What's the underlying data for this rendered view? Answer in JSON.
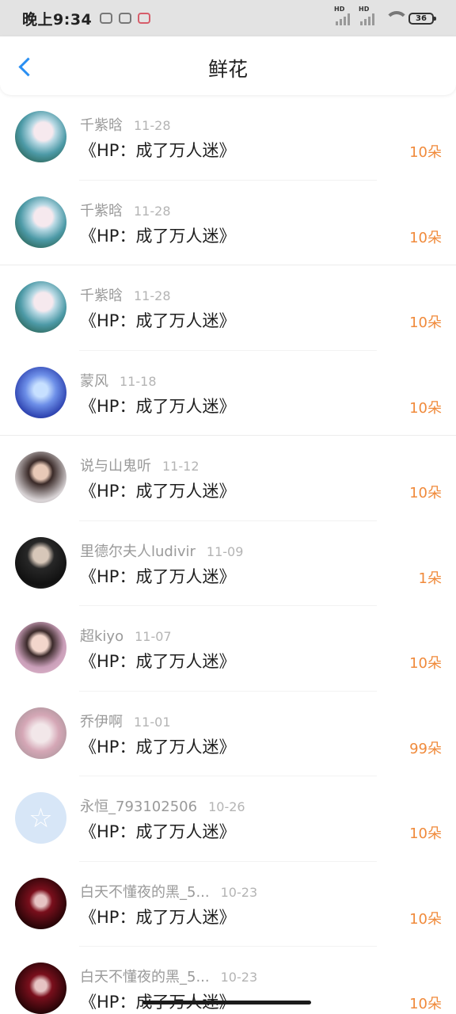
{
  "status_bar": {
    "time": "晚上9:34",
    "hd1": "HD",
    "hd2": "HD",
    "wifi_badge": "6",
    "battery": "36"
  },
  "header": {
    "title": "鲜花"
  },
  "items": [
    {
      "user": "千紫晗",
      "date": "11-28",
      "book": "《HP：成了万人迷》",
      "amount": "10朵"
    },
    {
      "user": "千紫晗",
      "date": "11-28",
      "book": "《HP：成了万人迷》",
      "amount": "10朵"
    },
    {
      "user": "千紫晗",
      "date": "11-28",
      "book": "《HP：成了万人迷》",
      "amount": "10朵"
    },
    {
      "user": "蒙风",
      "date": "11-18",
      "book": "《HP：成了万人迷》",
      "amount": "10朵"
    },
    {
      "user": "说与山鬼听",
      "date": "11-12",
      "book": "《HP：成了万人迷》",
      "amount": "10朵"
    },
    {
      "user": "里德尔夫人ludivir",
      "date": "11-09",
      "book": "《HP：成了万人迷》",
      "amount": "1朵"
    },
    {
      "user": "超kiyo",
      "date": "11-07",
      "book": "《HP：成了万人迷》",
      "amount": "10朵"
    },
    {
      "user": "乔伊啊",
      "date": "11-01",
      "book": "《HP：成了万人迷》",
      "amount": "99朵"
    },
    {
      "user": "永恒_793102506",
      "date": "10-26",
      "book": "《HP：成了万人迷》",
      "amount": "10朵"
    },
    {
      "user": "白天不懂夜的黑_5...",
      "date": "10-23",
      "book": "《HP：成了万人迷》",
      "amount": "10朵"
    },
    {
      "user": "白天不懂夜的黑_5...",
      "date": "10-23",
      "book": "《HP：成了万人迷》",
      "amount": "10朵"
    }
  ],
  "colors": {
    "accent": "#2a8ff2",
    "amount": "#f08a3b"
  }
}
